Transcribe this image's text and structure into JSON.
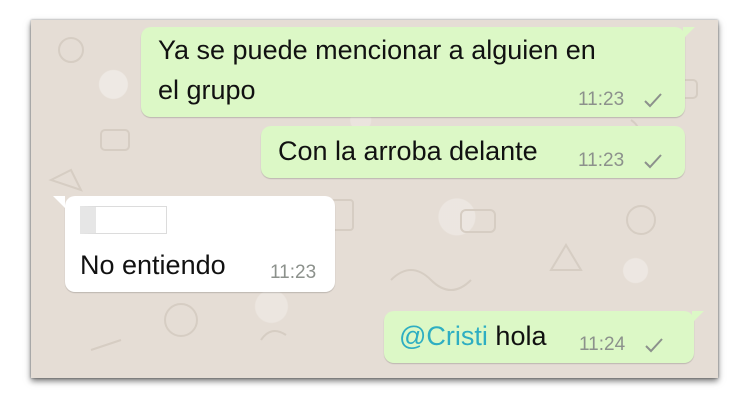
{
  "messages": [
    {
      "direction": "outgoing",
      "line1": "Ya se puede mencionar a alguien en",
      "line2": "el grupo",
      "time": "11:23",
      "status_icon": "check-icon"
    },
    {
      "direction": "outgoing",
      "text": "Con la arroba delante",
      "time": "11:23",
      "status_icon": "check-icon"
    },
    {
      "direction": "incoming",
      "text": "No entiendo",
      "time": "11:23"
    },
    {
      "direction": "outgoing",
      "mention": "@Cristi",
      "text": "hola",
      "time": "11:24",
      "status_icon": "check-icon"
    }
  ],
  "colors": {
    "outgoing_bubble": "#dcf8c6",
    "incoming_bubble": "#ffffff",
    "chat_background": "#e5ddd5",
    "mention": "#2eaec2",
    "timestamp": "#8c918c"
  }
}
